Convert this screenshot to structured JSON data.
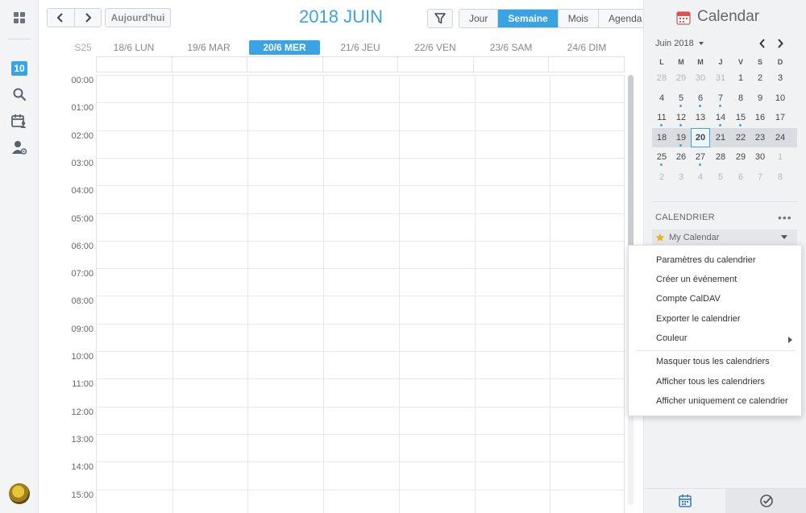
{
  "toolbar": {
    "today_label": "Aujourd'hui",
    "title": "2018 JUIN",
    "views": [
      {
        "label": "Jour",
        "active": false
      },
      {
        "label": "Semaine",
        "active": true
      },
      {
        "label": "Mois",
        "active": false
      },
      {
        "label": "Agenda",
        "active": false
      }
    ]
  },
  "week": {
    "number": "S25",
    "days": [
      {
        "label": "18/6 LUN",
        "today": false
      },
      {
        "label": "19/6 MAR",
        "today": false
      },
      {
        "label": "20/6 MER",
        "today": true
      },
      {
        "label": "21/6 JEU",
        "today": false
      },
      {
        "label": "22/6 VEN",
        "today": false
      },
      {
        "label": "23/6 SAM",
        "today": false
      },
      {
        "label": "24/6 DIM",
        "today": false
      }
    ]
  },
  "hours": [
    "00:00",
    "01:00",
    "02:00",
    "03:00",
    "04:00",
    "05:00",
    "06:00",
    "07:00",
    "08:00",
    "09:00",
    "10:00",
    "11:00",
    "12:00",
    "13:00",
    "14:00",
    "15:00"
  ],
  "rail": {
    "date_badge": "10",
    "icons": [
      "apps-grid-icon",
      "calendar-date-icon",
      "search-icon",
      "calendar-person-icon",
      "user-settings-icon"
    ]
  },
  "sidebar": {
    "app_title": "Calendar",
    "mini": {
      "month_label": "Juin 2018",
      "weekday_headers": [
        "L",
        "M",
        "M",
        "J",
        "V",
        "S",
        "D"
      ],
      "weeks": [
        [
          {
            "d": "28",
            "o": true
          },
          {
            "d": "29",
            "o": true
          },
          {
            "d": "30",
            "o": true
          },
          {
            "d": "31",
            "o": true
          },
          {
            "d": "1"
          },
          {
            "d": "2"
          },
          {
            "d": "3"
          }
        ],
        [
          {
            "d": "4"
          },
          {
            "d": "5",
            "dot": true
          },
          {
            "d": "6",
            "dot": true
          },
          {
            "d": "7",
            "dot": true
          },
          {
            "d": "8"
          },
          {
            "d": "9"
          },
          {
            "d": "10"
          }
        ],
        [
          {
            "d": "11",
            "dot": true
          },
          {
            "d": "12",
            "dot": true
          },
          {
            "d": "13"
          },
          {
            "d": "14",
            "dot": true
          },
          {
            "d": "15",
            "dot": true
          },
          {
            "d": "16"
          },
          {
            "d": "17"
          }
        ],
        [
          {
            "d": "18"
          },
          {
            "d": "19",
            "dot": true
          },
          {
            "d": "20",
            "today": true
          },
          {
            "d": "21"
          },
          {
            "d": "22"
          },
          {
            "d": "23"
          },
          {
            "d": "24"
          }
        ],
        [
          {
            "d": "25",
            "dot": true
          },
          {
            "d": "26"
          },
          {
            "d": "27",
            "dot": true
          },
          {
            "d": "28"
          },
          {
            "d": "29"
          },
          {
            "d": "30"
          },
          {
            "d": "1",
            "o": true
          }
        ],
        [
          {
            "d": "2",
            "o": true
          },
          {
            "d": "3",
            "o": true
          },
          {
            "d": "4",
            "o": true
          },
          {
            "d": "5",
            "o": true
          },
          {
            "d": "6",
            "o": true
          },
          {
            "d": "7",
            "o": true
          },
          {
            "d": "8",
            "o": true
          }
        ]
      ],
      "current_week_index": 3
    },
    "section_title": "CALENDRIER",
    "more_label": "•••",
    "my_calendar": "My Calendar"
  },
  "menu": {
    "items": [
      {
        "label": "Paramètres du calendrier"
      },
      {
        "label": "Créer un événement"
      },
      {
        "label": "Compte CalDAV"
      },
      {
        "label": "Exporter le calendrier"
      },
      {
        "label": "Couleur",
        "submenu": true
      },
      {
        "label": "Masquer tous les calendriers"
      },
      {
        "label": "Afficher tous les calendriers"
      },
      {
        "label": "Afficher uniquement ce calendrier"
      }
    ]
  },
  "colors": {
    "accent": "#3aa3e3",
    "dot": "#3aa3e3",
    "star": "#e8b21c"
  }
}
